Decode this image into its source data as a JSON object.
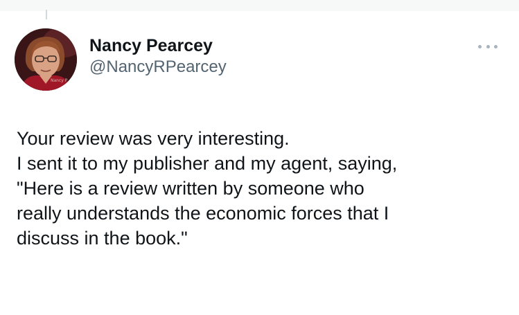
{
  "tweet": {
    "author_name": "Nancy Pearcey",
    "author_handle": "@NancyRPearcey",
    "avatar_caption": "Nancy P",
    "more_icon": "more-horizontal-icon",
    "text_lines": [
      "Your review was very interesting.",
      "I sent it to my publisher and my agent, saying,",
      "\"Here is a review written by someone who",
      "really understands the economic forces that I",
      "discuss in the book.\""
    ]
  },
  "colors": {
    "text": "#0f1419",
    "secondary_text": "#536471",
    "icon_gray": "#a7b4bd",
    "thread_line": "#cfd9de"
  }
}
